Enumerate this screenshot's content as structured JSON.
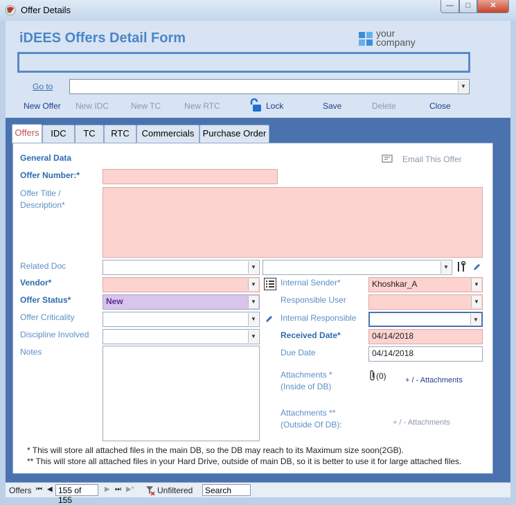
{
  "window": {
    "title": "Offer Details",
    "min": "—",
    "max": "□",
    "close": "✕"
  },
  "header": {
    "form_title": "iDEES Offers Detail Form",
    "logo_line1": "your",
    "logo_line2": "company",
    "goto_label": "Go to",
    "goto_value": ""
  },
  "toolbar": {
    "new_offer": "New Offer",
    "new_idc": "New IDC",
    "new_tc": "New TC",
    "new_rtc": "New RTC",
    "lock": "Lock",
    "save": "Save",
    "delete": "Delete",
    "close": "Close"
  },
  "tabs": [
    "Offers",
    "IDC",
    "TC",
    "RTC",
    "Commercials",
    "Purchase Order"
  ],
  "form": {
    "general_data": "General Data",
    "email_offer": "Email This Offer",
    "offer_number_label": "Offer Number:*",
    "offer_number": "",
    "offer_title_label_1": "Offer Title /",
    "offer_title_label_2": "Description*",
    "offer_title": "",
    "related_doc_label": "Related Doc",
    "related_doc": "",
    "related_doc_2": "",
    "vendor_label": "Vendor*",
    "vendor": "",
    "offer_status_label": "Offer Status*",
    "offer_status": "New",
    "offer_criticality_label": "Offer Criticality",
    "offer_criticality": "",
    "discipline_label": "Discipline Involved",
    "discipline": "",
    "notes_label": "Notes",
    "notes": "",
    "internal_sender_label": "Internal Sender*",
    "internal_sender": "Khoshkar_A",
    "responsible_user_label": "Responsible User",
    "responsible_user": "",
    "internal_responsible_label": "Internal Responsible",
    "internal_responsible": "",
    "received_date_label": "Received Date*",
    "received_date": "04/14/2018",
    "due_date_label": "Due Date",
    "due_date": "04/14/2018",
    "attach_in_label_1": "Attachments *",
    "attach_in_label_2": "(Inside of DB)",
    "attach_count": "(0)",
    "attach_in_link": "+ / -  Attachments",
    "attach_out_label_1": "Attachments **",
    "attach_out_label_2": "(Outside Of DB):",
    "attach_out_link": "+ / -  Attachments",
    "note_1": "*  This will store all attached files in the main DB, so the DB may reach to its Maximum size soon(2GB).",
    "note_2": "** This will store all attached files in your Hard Drive, outside of main DB, so it is better to use it for large attached files."
  },
  "statusbar": {
    "label": "Offers",
    "record": "155 of 155",
    "filter": "Unfiltered",
    "search": "Search"
  },
  "colors": {
    "frame": "#4a72ae",
    "required": "#fdd3d0",
    "status": "#d9c4ee",
    "title": "#4a86c8"
  }
}
